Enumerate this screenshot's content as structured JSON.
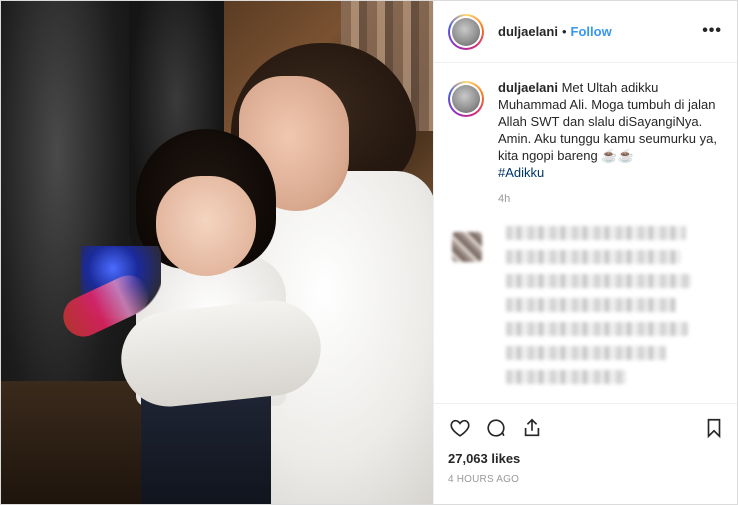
{
  "post": {
    "username": "duljaelani",
    "follow_label": "Follow",
    "separator": "•",
    "more_icon": "more-horizontal-icon",
    "more_label": "•••"
  },
  "caption": {
    "username": "duljaelani",
    "text": "Met Ultah adikku Muhammad Ali. Moga tumbuh di jalan Allah SWT dan slalu diSayangiNya. Amin. Aku tunggu kamu seumurku ya, kita ngopi bareng ☕☕",
    "hashtag": "#Adikku",
    "time": "4h"
  },
  "actions": {
    "like_icon": "heart-icon",
    "comment_icon": "comment-icon",
    "share_icon": "share-icon",
    "save_icon": "bookmark-icon"
  },
  "likes": "27,063 likes",
  "timestamp": "4 HOURS AGO",
  "colors": {
    "accent": "#3897f0",
    "text": "#262626",
    "muted": "#999999",
    "hashtag": "#003569",
    "border": "#efefef"
  }
}
